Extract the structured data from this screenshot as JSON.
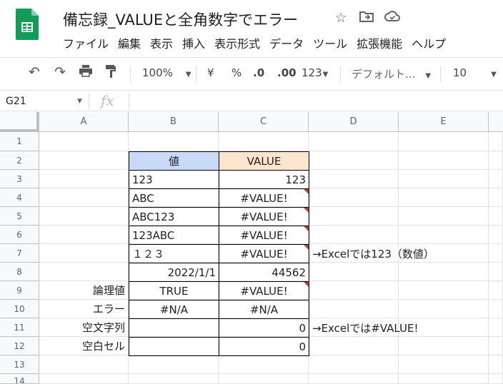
{
  "app": {
    "title": "備忘録_VALUEと全角数字でエラー",
    "menu": [
      "ファイル",
      "編集",
      "表示",
      "挿入",
      "表示形式",
      "データ",
      "ツール",
      "拡張機能",
      "ヘルプ"
    ],
    "title_icons": [
      "star-icon",
      "move-to-folder-icon",
      "cloud-status-icon"
    ]
  },
  "toolbar": {
    "zoom": "100%",
    "currency": "¥",
    "percent": "%",
    "dec_less": ".0",
    "dec_more": ".00",
    "format_123": "123",
    "font": "デフォルト...",
    "font_size": "10"
  },
  "formula_bar": {
    "name_box": "G21",
    "fx": "fx"
  },
  "grid": {
    "columns": [
      "A",
      "B",
      "C",
      "D",
      "E"
    ],
    "rows": [
      "1",
      "2",
      "3",
      "4",
      "5",
      "6",
      "7",
      "8",
      "9",
      "10",
      "11",
      "12",
      "13",
      "14"
    ],
    "cells": {
      "B2": "値",
      "C2": "VALUE",
      "B3": "123",
      "C3": "123",
      "B4": "ABC",
      "C4": "#VALUE!",
      "B5": "ABC123",
      "C5": "#VALUE!",
      "B6": "123ABC",
      "C6": "#VALUE!",
      "B7": "１２３",
      "C7": "#VALUE!",
      "D7": "→Excelでは123（数値）",
      "B8": "2022/1/1",
      "C8": "44562",
      "A9": "論理値",
      "B9": "TRUE",
      "C9": "#VALUE!",
      "A10": "エラー",
      "B10": "#N/A",
      "C10": "#N/A",
      "A11": "空文字列",
      "B11": "",
      "C11": "0",
      "D11": "→Excelでは#VALUE!",
      "A12": "空白セル",
      "B12": "",
      "C12": "0"
    }
  },
  "colors": {
    "header_b": "#c9daf8",
    "header_c": "#fce5cd",
    "error_marker": "#c0392b",
    "sheets_green": "#0f9d58"
  }
}
